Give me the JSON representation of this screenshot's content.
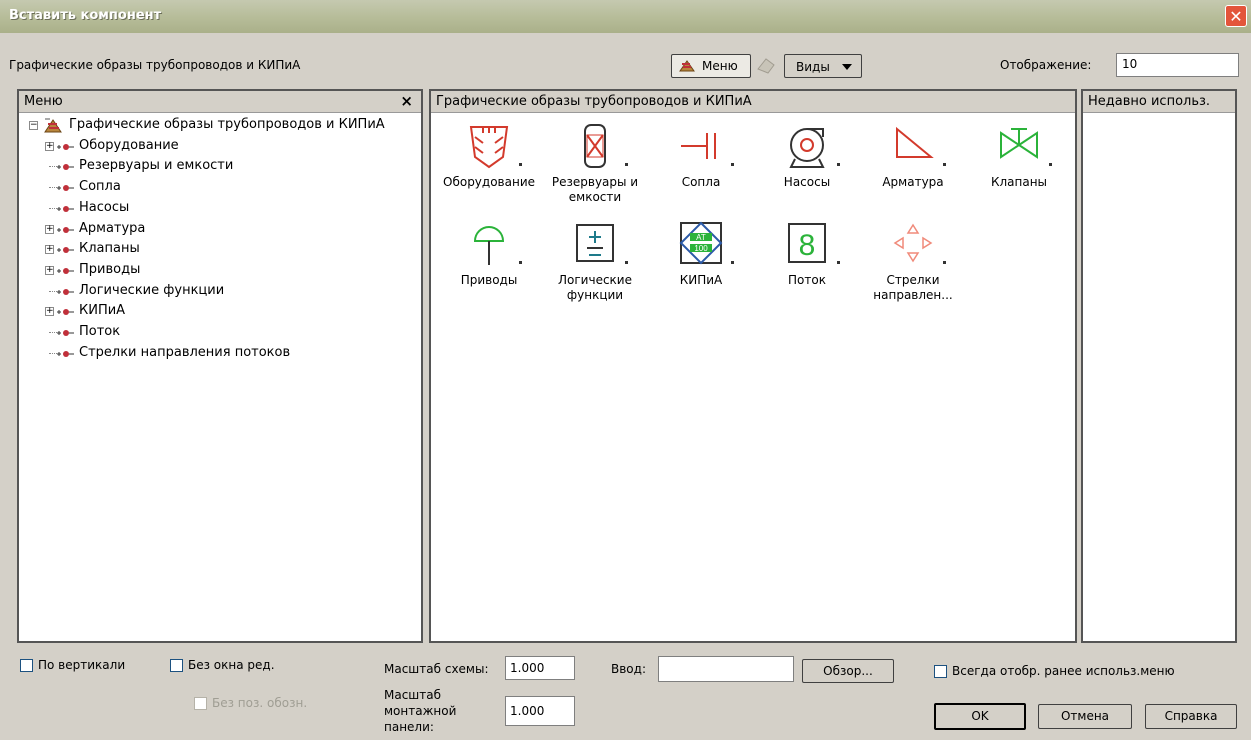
{
  "window": {
    "title": "Вставить компонент"
  },
  "toolbar": {
    "category_title": "Графические образы трубопроводов и КИПиА",
    "menu_button": "Меню",
    "views_button": "Виды",
    "display_label": "Отображение:",
    "display_value": "10"
  },
  "left_panel": {
    "header": "Меню",
    "close": "×",
    "tree": [
      {
        "label": "Графические образы трубопроводов и КИПиА",
        "level": 0,
        "expander": "minus"
      },
      {
        "label": "Оборудование",
        "level": 1,
        "expander": "plus"
      },
      {
        "label": "Резервуары и емкости",
        "level": 1,
        "expander": "none"
      },
      {
        "label": "Сопла",
        "level": 1,
        "expander": "none"
      },
      {
        "label": "Насосы",
        "level": 1,
        "expander": "none"
      },
      {
        "label": "Арматура",
        "level": 1,
        "expander": "plus"
      },
      {
        "label": "Клапаны",
        "level": 1,
        "expander": "plus"
      },
      {
        "label": "Приводы",
        "level": 1,
        "expander": "plus"
      },
      {
        "label": "Логические функции",
        "level": 1,
        "expander": "none"
      },
      {
        "label": "КИПиА",
        "level": 1,
        "expander": "plus"
      },
      {
        "label": "Поток",
        "level": 1,
        "expander": "none"
      },
      {
        "label": "Стрелки направления потоков",
        "level": 1,
        "expander": "none"
      }
    ]
  },
  "center_panel": {
    "header": "Графические образы трубопроводов и КИПиА",
    "items": [
      {
        "label": "Оборудование",
        "icon": "equipment-icon"
      },
      {
        "label": "Резервуары и емкости",
        "icon": "tank-icon"
      },
      {
        "label": "Сопла",
        "icon": "nozzle-icon"
      },
      {
        "label": "Насосы",
        "icon": "pump-icon"
      },
      {
        "label": "Арматура",
        "icon": "fitting-icon"
      },
      {
        "label": "Клапаны",
        "icon": "valve-icon"
      },
      {
        "label": "Приводы",
        "icon": "actuator-icon"
      },
      {
        "label": "Логические функции",
        "icon": "logic-icon"
      },
      {
        "label": "КИПиА",
        "icon": "instrument-icon"
      },
      {
        "label": "Поток",
        "icon": "flow-icon"
      },
      {
        "label": "Стрелки направлен...",
        "icon": "arrows-icon"
      }
    ],
    "instrument_text_top": "AT",
    "instrument_text_bottom": "100",
    "flow_text": "8"
  },
  "right_panel": {
    "header": "Недавно использ."
  },
  "bottom": {
    "vertical_label": "По вертикали",
    "no_edit_label": "Без окна ред.",
    "no_pos_label": "Без поз. обозн.",
    "scheme_scale_label": "Масштаб схемы:",
    "scheme_scale_value": "1.000",
    "panel_scale_label_1": "Масштаб",
    "panel_scale_label_2": "монтажной",
    "panel_scale_label_3": "панели:",
    "panel_scale_value": "1.000",
    "input_label": "Ввод:",
    "input_value": "",
    "browse_button": "Обзор...",
    "always_show_label": "Всегда отобр. ранее использ.меню",
    "ok_button": "OK",
    "cancel_button": "Отмена",
    "help_button": "Справка"
  },
  "colors": {
    "icon_red": "#d33a2c",
    "icon_blue": "#2b5aa8",
    "icon_green": "#2bb33a",
    "icon_teal": "#1e7a8a"
  }
}
